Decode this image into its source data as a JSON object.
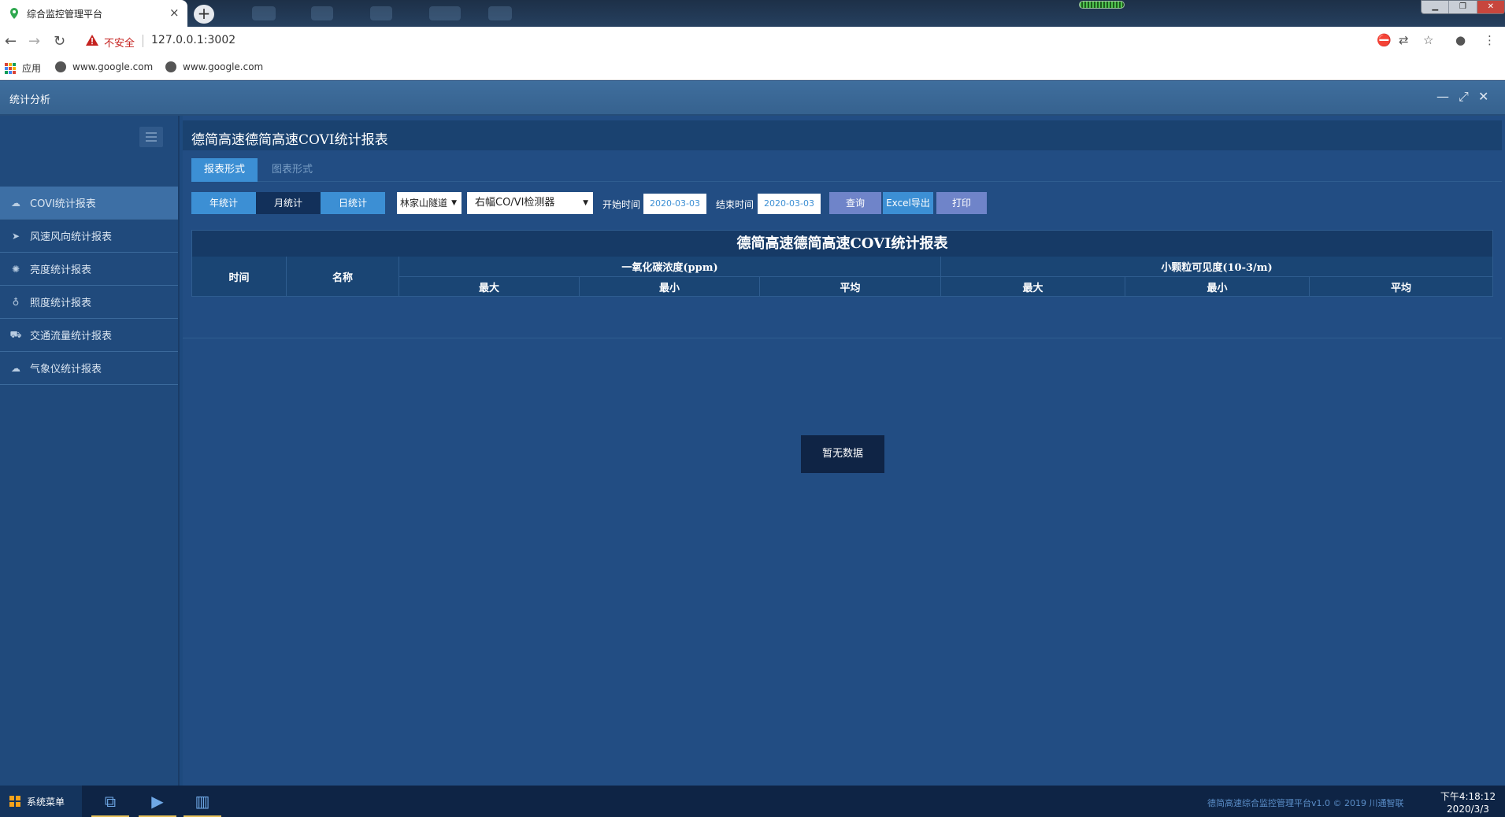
{
  "browser": {
    "tab_title": "综合监控管理平台",
    "tab_close": "×",
    "new_tab": "+",
    "security_label": "不安全",
    "url": "127.0.0.1:3002",
    "bookmarks": [
      "应用",
      "www.google.com",
      "www.google.com"
    ]
  },
  "app": {
    "window_title": "统计分析",
    "controls": {
      "minimize": "—",
      "maximize": "⤢",
      "close": "✕"
    }
  },
  "sidebar": {
    "items": [
      {
        "label": "COVI统计报表",
        "icon": "cloud-icon",
        "active": true
      },
      {
        "label": "风速风向统计报表",
        "icon": "paper-plane-icon",
        "active": false
      },
      {
        "label": "亮度统计报表",
        "icon": "sun-icon",
        "active": false
      },
      {
        "label": "照度统计报表",
        "icon": "bulb-icon",
        "active": false
      },
      {
        "label": "交通流量统计报表",
        "icon": "car-icon",
        "active": false
      },
      {
        "label": "气象仪统计报表",
        "icon": "cloud-icon",
        "active": false
      }
    ]
  },
  "main": {
    "title": "德简高速德简高速COVI统计报表",
    "mode_tabs": [
      "报表形式",
      "图表形式"
    ],
    "period_buttons": [
      "年统计",
      "月统计",
      "日统计"
    ],
    "tunnel_select": "林家山隧道",
    "detector_select": "右幅CO/VI检测器",
    "start_label": "开始时间",
    "start_date": "2020-03-03",
    "end_label": "结束时间",
    "end_date": "2020-03-03",
    "query_button": "查询",
    "excel_button": "Excel导出",
    "print_button": "打印",
    "report": {
      "title": "德简高速德简高速COVI统计报表",
      "col_time": "时间",
      "col_name": "名称",
      "group_co": "一氧化碳浓度(ppm)",
      "group_vi": "小颗粒可见度(10-3/m)",
      "sub": [
        "最大",
        "最小",
        "平均",
        "最大",
        "最小",
        "平均"
      ]
    },
    "empty_text": "暂无数据"
  },
  "taskbar": {
    "start_label": "系统菜单",
    "footer": "德简高速综合监控管理平台v1.0 © 2019 川通智联",
    "time": "下午4:18:12",
    "date": "2020/3/3"
  },
  "colors": {
    "accent": "#3c8fd4",
    "panel": "#224d83",
    "sidebar": "#204a7c",
    "active_nav": "#3d6fa5",
    "header": "#3f6e9d"
  }
}
